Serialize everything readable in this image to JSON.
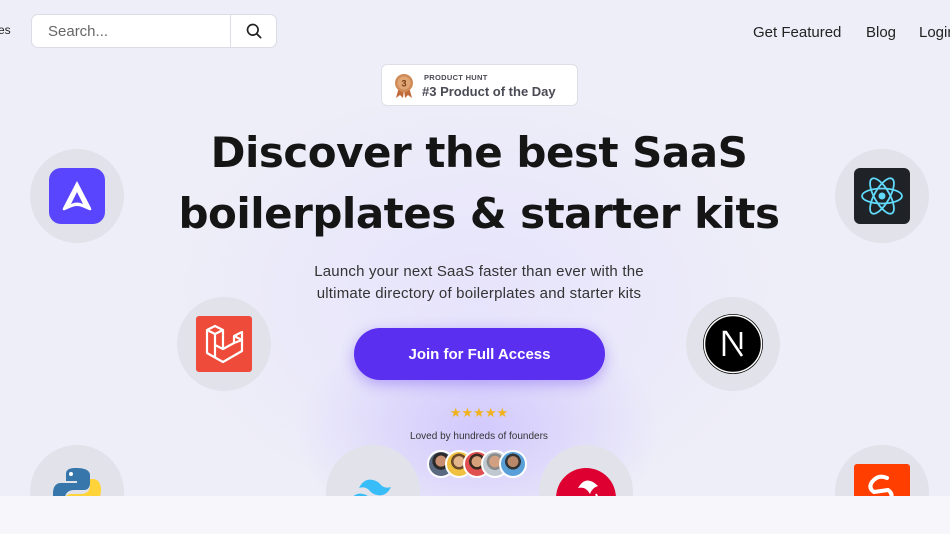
{
  "nav": {
    "brand_fragment": "es",
    "search_placeholder": "Search...",
    "links": [
      "Get Featured",
      "Blog",
      "Login"
    ]
  },
  "badge": {
    "small": "PRODUCT HUNT",
    "big": "#3 Product of the Day",
    "rank": "3"
  },
  "hero": {
    "headline_line1": "Discover the best SaaS",
    "headline_line2": "boilerplates & starter kits",
    "sub_line1": "Launch your next SaaS faster than ever with the",
    "sub_line2": "ultimate directory of boilerplates and starter kits",
    "cta": "Join for Full Access",
    "stars": "★★★★★",
    "loved": "Loved by hundreds of founders"
  },
  "icons": [
    "adonis-logo-icon",
    "laravel-logo-icon",
    "python-logo-icon",
    "tailwind-logo-icon",
    "angular-logo-icon",
    "nextjs-logo-icon",
    "react-logo-icon",
    "svelte-logo-icon"
  ],
  "colors": {
    "accent": "#5b2ff0",
    "star": "#f1b21d"
  }
}
